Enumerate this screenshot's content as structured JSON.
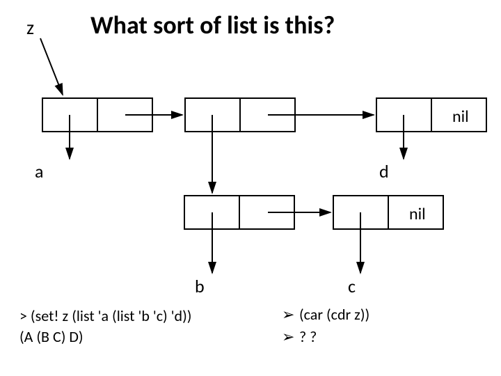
{
  "title": "What sort of list is this?",
  "labels": {
    "z": "z",
    "a": "a",
    "b": "b",
    "c": "c",
    "d": "d",
    "nil1": "nil",
    "nil2": "nil"
  },
  "code": {
    "line1": "> (set!  z  (list  'a  (list  'b 'c)  'd))",
    "line2": "(A  (B  C)  D)",
    "ans1": "(car  (cdr  z))",
    "ans2": "? ?",
    "bullet": "➢"
  },
  "chart_data": {
    "type": "diagram",
    "description": "Box-and-pointer diagram of a nested Lisp list",
    "structure": {
      "z": [
        "a",
        [
          "b",
          "c"
        ],
        "d"
      ]
    },
    "cons_cells": [
      {
        "id": "top1",
        "car": "a",
        "cdr": "top2"
      },
      {
        "id": "top2",
        "car": "sub1",
        "cdr": "top3"
      },
      {
        "id": "top3",
        "car": "d",
        "cdr": "nil"
      },
      {
        "id": "sub1",
        "car": "b",
        "cdr": "sub2"
      },
      {
        "id": "sub2",
        "car": "c",
        "cdr": "nil"
      }
    ],
    "prompt": "> (set! z (list 'a (list 'b 'c) 'd))",
    "result": "(A (B C) D)",
    "questions": [
      "(car (cdr z))",
      "? ?"
    ]
  }
}
